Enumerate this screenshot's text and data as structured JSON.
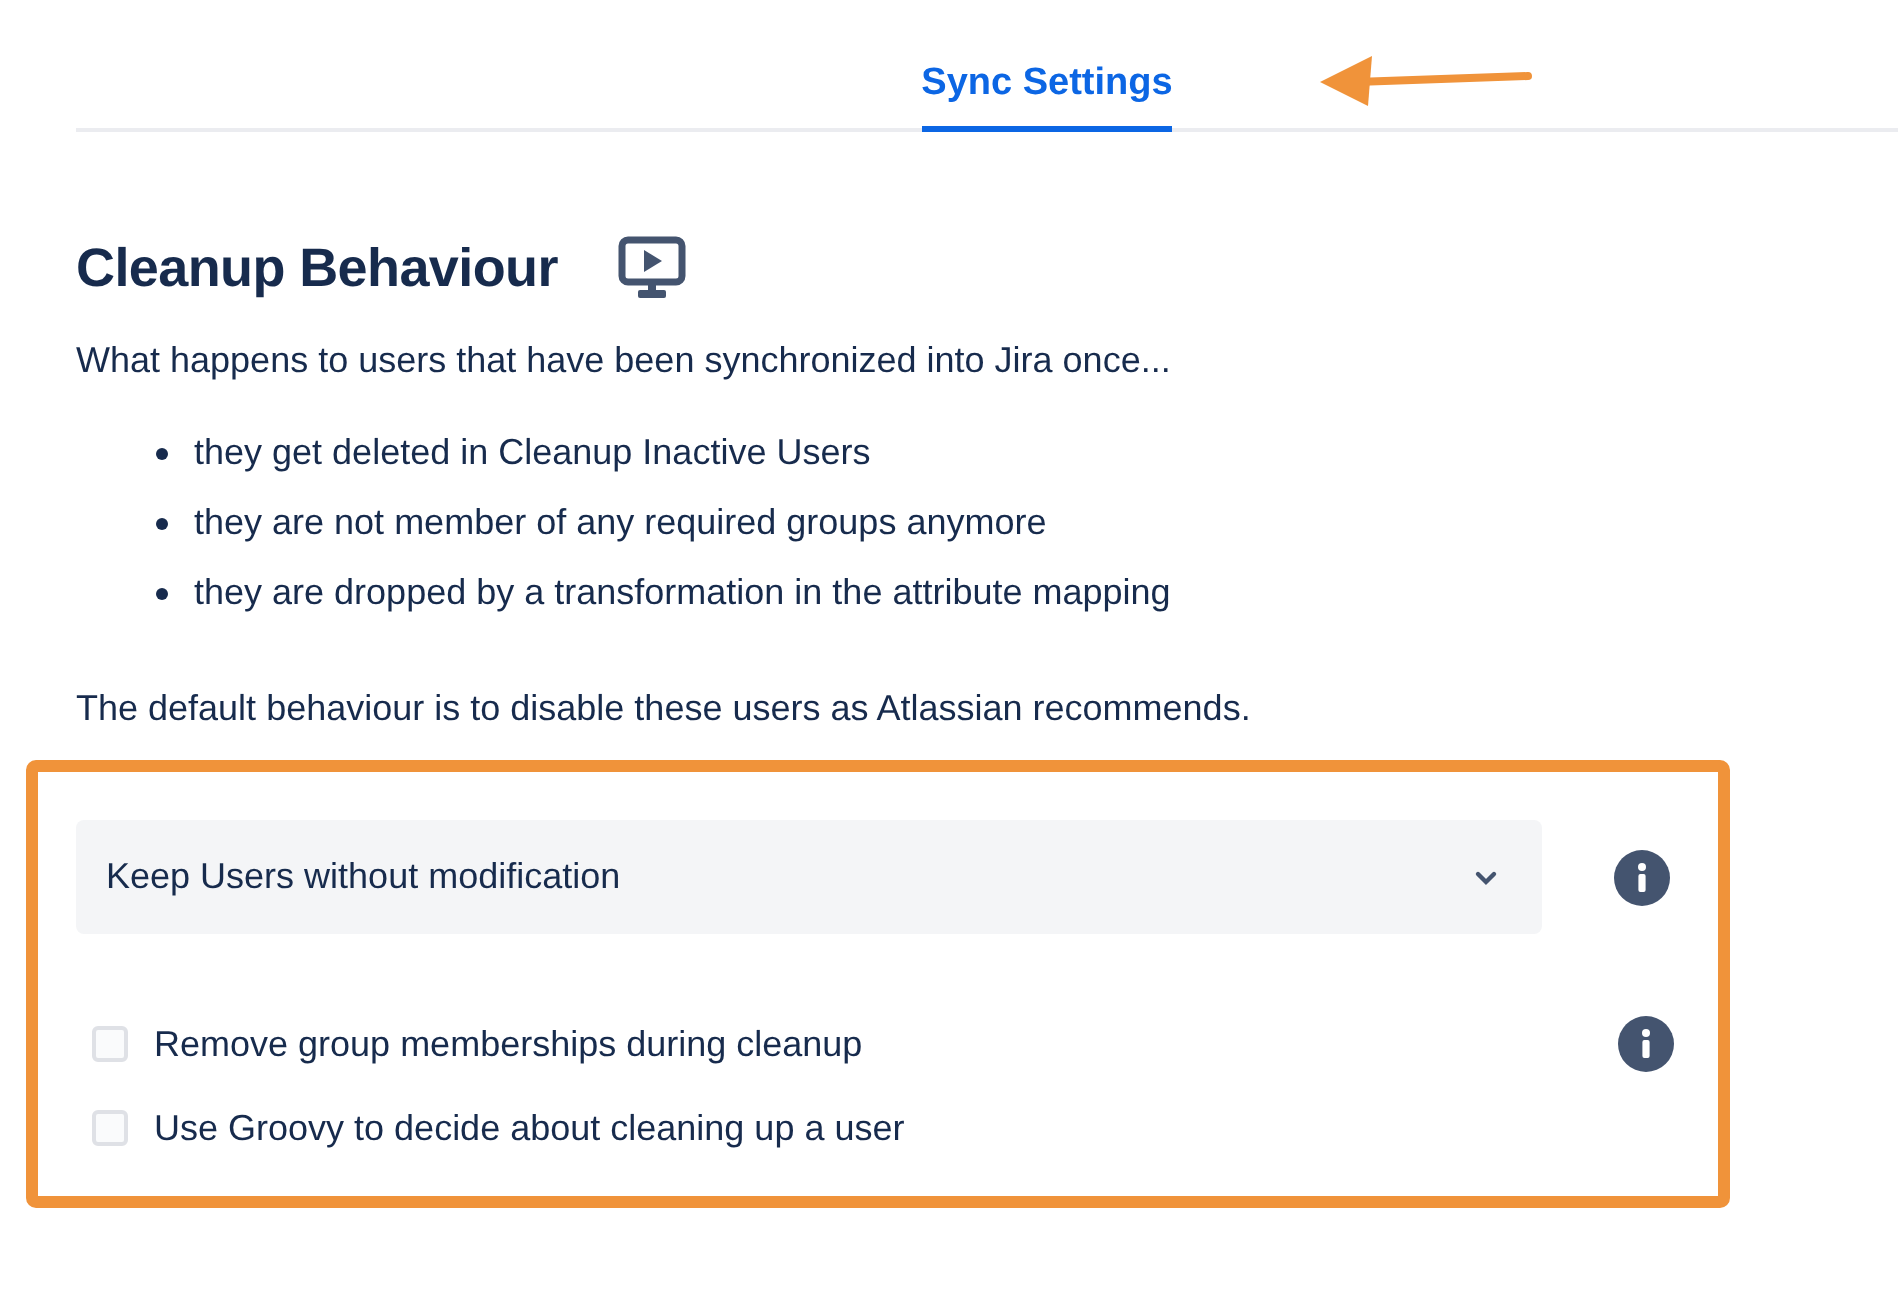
{
  "tabs": [
    {
      "label": "Sync Settings",
      "selected": true
    }
  ],
  "section": {
    "title": "Cleanup Behaviour",
    "intro": "What happens to users that have been synchronized into Jira once...",
    "bullets": [
      "they get deleted in Cleanup Inactive Users",
      "they are not member of any required groups anymore",
      "they are dropped by a transformation in the attribute mapping"
    ],
    "note": "The default behaviour is to disable these users as Atlassian recommends."
  },
  "dropdown": {
    "value": "Keep Users without modification"
  },
  "options": [
    {
      "label": "Remove group memberships during cleanup",
      "checked": false,
      "info": true
    },
    {
      "label": "Use Groovy to decide about cleaning up a user",
      "checked": false,
      "info": false
    }
  ]
}
